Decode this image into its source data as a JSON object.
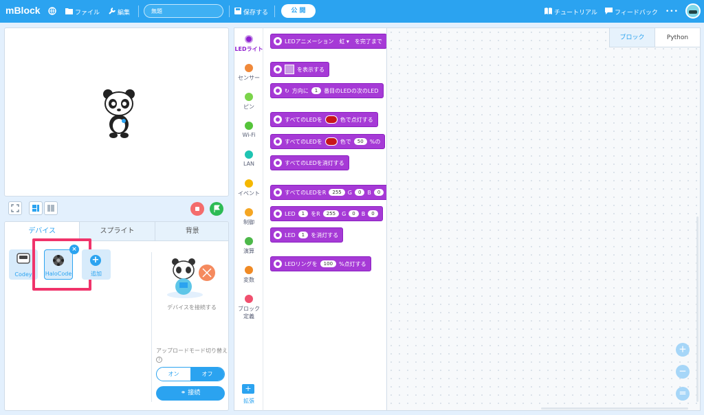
{
  "topbar": {
    "logo": "mBlock",
    "file_label": "ファイル",
    "edit_label": "編集",
    "project_title": "無題",
    "save_label": "保存する",
    "publish_label": "公 開",
    "tutorial_label": "チュートリアル",
    "feedback_label": "フィードバック",
    "more_label": "•••"
  },
  "device_panel": {
    "tabs": [
      "デバイス",
      "スプライト",
      "背景"
    ],
    "devices": [
      {
        "label": "Codey",
        "icon": "codey-robot-icon"
      },
      {
        "label": "HaloCode",
        "icon": "halocode-board-icon",
        "selected": true
      }
    ],
    "add_label": "追加",
    "connect_caption": "デバイスを接続する",
    "upload_mode_label": "アップロードモード切り替え",
    "toggle_on": "オン",
    "toggle_off": "オフ",
    "connect_button": "接続"
  },
  "categories": [
    {
      "label": "LEDライト",
      "color": "#8f1fd0"
    },
    {
      "label": "センサー",
      "color": "#f0893a"
    },
    {
      "label": "ピン",
      "color": "#7bd44a"
    },
    {
      "label": "Wi-Fi",
      "color": "#55c43a"
    },
    {
      "label": "LAN",
      "color": "#1fc4b2"
    },
    {
      "label": "イベント",
      "color": "#f5b800"
    },
    {
      "label": "制御",
      "color": "#f5a623"
    },
    {
      "label": "演算",
      "color": "#4db849"
    },
    {
      "label": "変数",
      "color": "#f08a24"
    },
    {
      "label": "ブロック定義",
      "color": "#f0506e"
    }
  ],
  "extension_label": "拡張",
  "blocks": {
    "b1": "LEDアニメーション　虹 ▾　を完了まで",
    "b2": "を表示する",
    "b3_a": "方向に",
    "b3_n": "1",
    "b3_b": "番目のLEDの次のLED",
    "b4_a": "すべてのLEDを",
    "b4_b": "色で点灯する",
    "b5_a": "すべてのLEDを",
    "b5_b": "色で",
    "b5_n": "50",
    "b5_c": "%の",
    "b6": "すべてのLEDを消灯する",
    "b7_a": "すべてのLEDをR",
    "b7_r": "255",
    "b7_g": "G",
    "b7_gv": "0",
    "b7_b": "B",
    "b7_bv": "0",
    "b8_a": "LED",
    "b8_n": "1",
    "b8_b": "をR",
    "b8_r": "255",
    "b8_g": "G",
    "b8_gv": "0",
    "b8_bl": "B",
    "b8_bv": "0",
    "b9_a": "LED",
    "b9_n": "1",
    "b9_b": "を消灯する",
    "b10_a": "LEDリングを",
    "b10_n": "100",
    "b10_b": "%点灯する"
  },
  "code_tabs": [
    "ブロック",
    "Python"
  ],
  "zoom": [
    "＋",
    "－",
    "＝"
  ]
}
